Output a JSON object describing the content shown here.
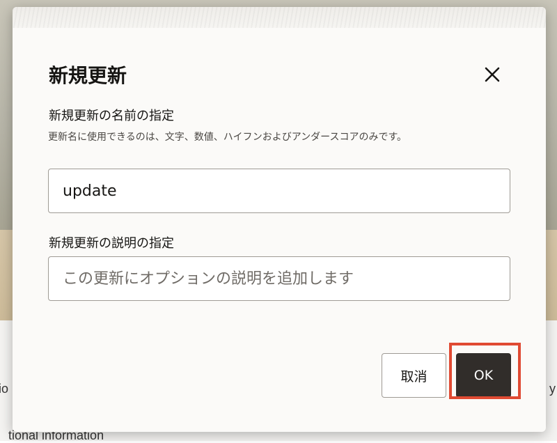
{
  "dialog": {
    "title": "新規更新",
    "name_label": "新規更新の名前の指定",
    "name_help": "更新名に使用できるのは、文字、数値、ハイフンおよびアンダースコアのみです。",
    "name_value": "update",
    "description_label": "新規更新の説明の指定",
    "description_placeholder": "この更新にオプションの説明を追加します",
    "cancel_label": "取消",
    "ok_label": "OK"
  },
  "background": {
    "left_fragment": "io",
    "right_fragment": "y",
    "bottom_fragment": "tional information"
  },
  "colors": {
    "primary_button": "#312d2a",
    "highlight": "#e04a33",
    "dialog_bg": "#fbfaf8"
  },
  "icons": {
    "close": "close-icon"
  }
}
